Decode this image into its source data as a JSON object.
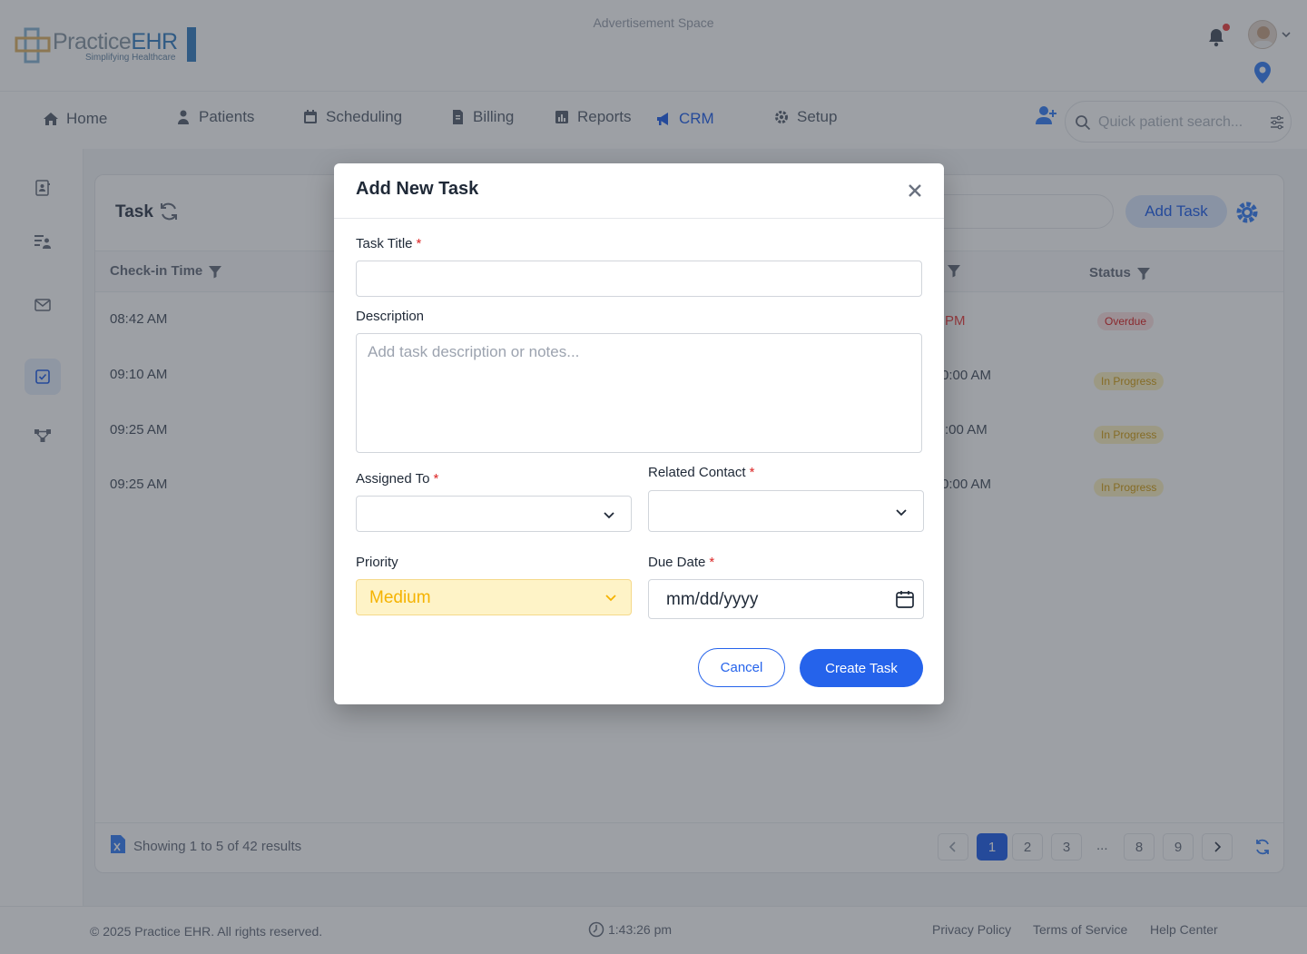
{
  "header": {
    "logo_text_main": "Practice",
    "logo_text_brand": "EHR",
    "logo_tagline": "Simplifying Healthcare",
    "ad_space": "Advertisement Space"
  },
  "nav": {
    "items": [
      {
        "label": "Home",
        "icon": "home-icon"
      },
      {
        "label": "Patients",
        "icon": "user-icon"
      },
      {
        "label": "Scheduling",
        "icon": "calendar-icon"
      },
      {
        "label": "Billing",
        "icon": "receipt-icon"
      },
      {
        "label": "Reports",
        "icon": "chart-icon"
      },
      {
        "label": "CRM",
        "icon": "megaphone-icon",
        "active": true
      },
      {
        "label": "Setup",
        "icon": "gear-icon"
      }
    ],
    "search_placeholder": "Quick patient search..."
  },
  "task_page": {
    "title": "Task",
    "add_task_label": "Add Task",
    "columns": {
      "checkin": "Check-in Time",
      "status": "Status"
    },
    "rows": [
      {
        "checkin": "08:42 AM",
        "due": "PM",
        "status": "Overdue",
        "status_type": "overdue"
      },
      {
        "checkin": "09:10 AM",
        "due": "0:00 AM",
        "status": "In Progress",
        "status_type": "progress"
      },
      {
        "checkin": "09:25 AM",
        "due": ":00 AM",
        "status": "In Progress",
        "status_type": "progress"
      },
      {
        "checkin": "09:25 AM",
        "due": "0:00 AM",
        "status": "In Progress",
        "status_type": "progress"
      }
    ],
    "showing": "Showing 1 to 5 of 42 results",
    "pages": [
      "1",
      "2",
      "3",
      "8",
      "9"
    ],
    "ellipsis": "..."
  },
  "footer": {
    "copyright": "© 2025 Practice EHR. All rights reserved.",
    "time": "1:43:26 pm",
    "links": [
      "Privacy Policy",
      "Terms of Service",
      "Help Center"
    ]
  },
  "modal": {
    "title": "Add New Task",
    "task_title_label": "Task Title",
    "description_label": "Description",
    "description_placeholder": "Add task description or notes...",
    "assigned_to_label": "Assigned To",
    "related_contact_label": "Related Contact",
    "priority_label": "Priority",
    "priority_value": "Medium",
    "due_date_label": "Due Date",
    "due_date_placeholder": "mm/dd/yyyy",
    "required_mark": "*",
    "cancel_label": "Cancel",
    "create_label": "Create Task"
  },
  "colors": {
    "accent": "#2563eb",
    "priority_bg": "#fef3c7",
    "priority_text": "#f5b301",
    "required": "#dc2626"
  }
}
